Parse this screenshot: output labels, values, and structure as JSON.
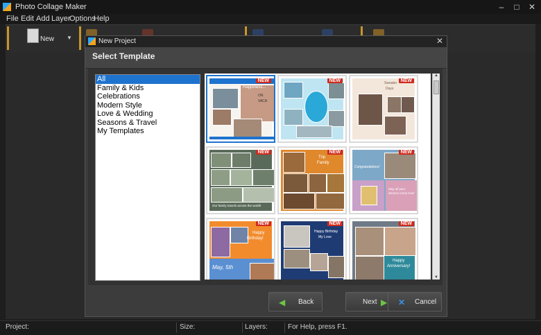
{
  "window": {
    "title": "Photo Collage Maker",
    "minimize": "–",
    "maximize": "□",
    "close": "✕"
  },
  "menu": [
    "File",
    "Edit",
    "Add",
    "Layer",
    "Options",
    "Help"
  ],
  "toolbar": {
    "new_label": "New"
  },
  "dialog": {
    "title": "New Project",
    "close": "✕",
    "heading": "Select Template",
    "categories": [
      "All",
      "Family & Kids",
      "Celebrations",
      "Modern Style",
      "Love & Wedding",
      "Seasons & Travel",
      "My Templates"
    ],
    "selected_category": "All",
    "templates": [
      {
        "badge": "NEW",
        "texts": [
          "Happiness...",
          "ON",
          "VACA"
        ]
      },
      {
        "badge": "NEW",
        "texts": []
      },
      {
        "badge": "NEW",
        "texts": [
          "Sweater",
          "Days"
        ]
      },
      {
        "badge": "NEW",
        "texts": [
          "Our family travels across the world!"
        ]
      },
      {
        "badge": "NEW",
        "texts": [
          "Trip",
          "Family"
        ]
      },
      {
        "badge": "NEW",
        "texts": [
          "Congratulations!",
          "May all your dreams come true!"
        ]
      },
      {
        "badge": "NEW",
        "texts": [
          "Happy",
          "Birthday!",
          "May, 5th"
        ]
      },
      {
        "badge": "NEW",
        "texts": [
          "Happy Birthday",
          "My Love"
        ]
      },
      {
        "badge": "NEW",
        "texts": [
          "Happy",
          "Anniversary!"
        ]
      }
    ],
    "buttons": {
      "back": "Back",
      "next": "Next",
      "cancel": "Cancel"
    }
  },
  "statusbar": {
    "project": "Project:",
    "size": "Size:",
    "layers": "Layers:",
    "help": "For Help, press F1."
  },
  "colors": {
    "selection": "#1e73cf",
    "badge": "#cf2a1d",
    "toolbar_separator": "#c9962a"
  }
}
